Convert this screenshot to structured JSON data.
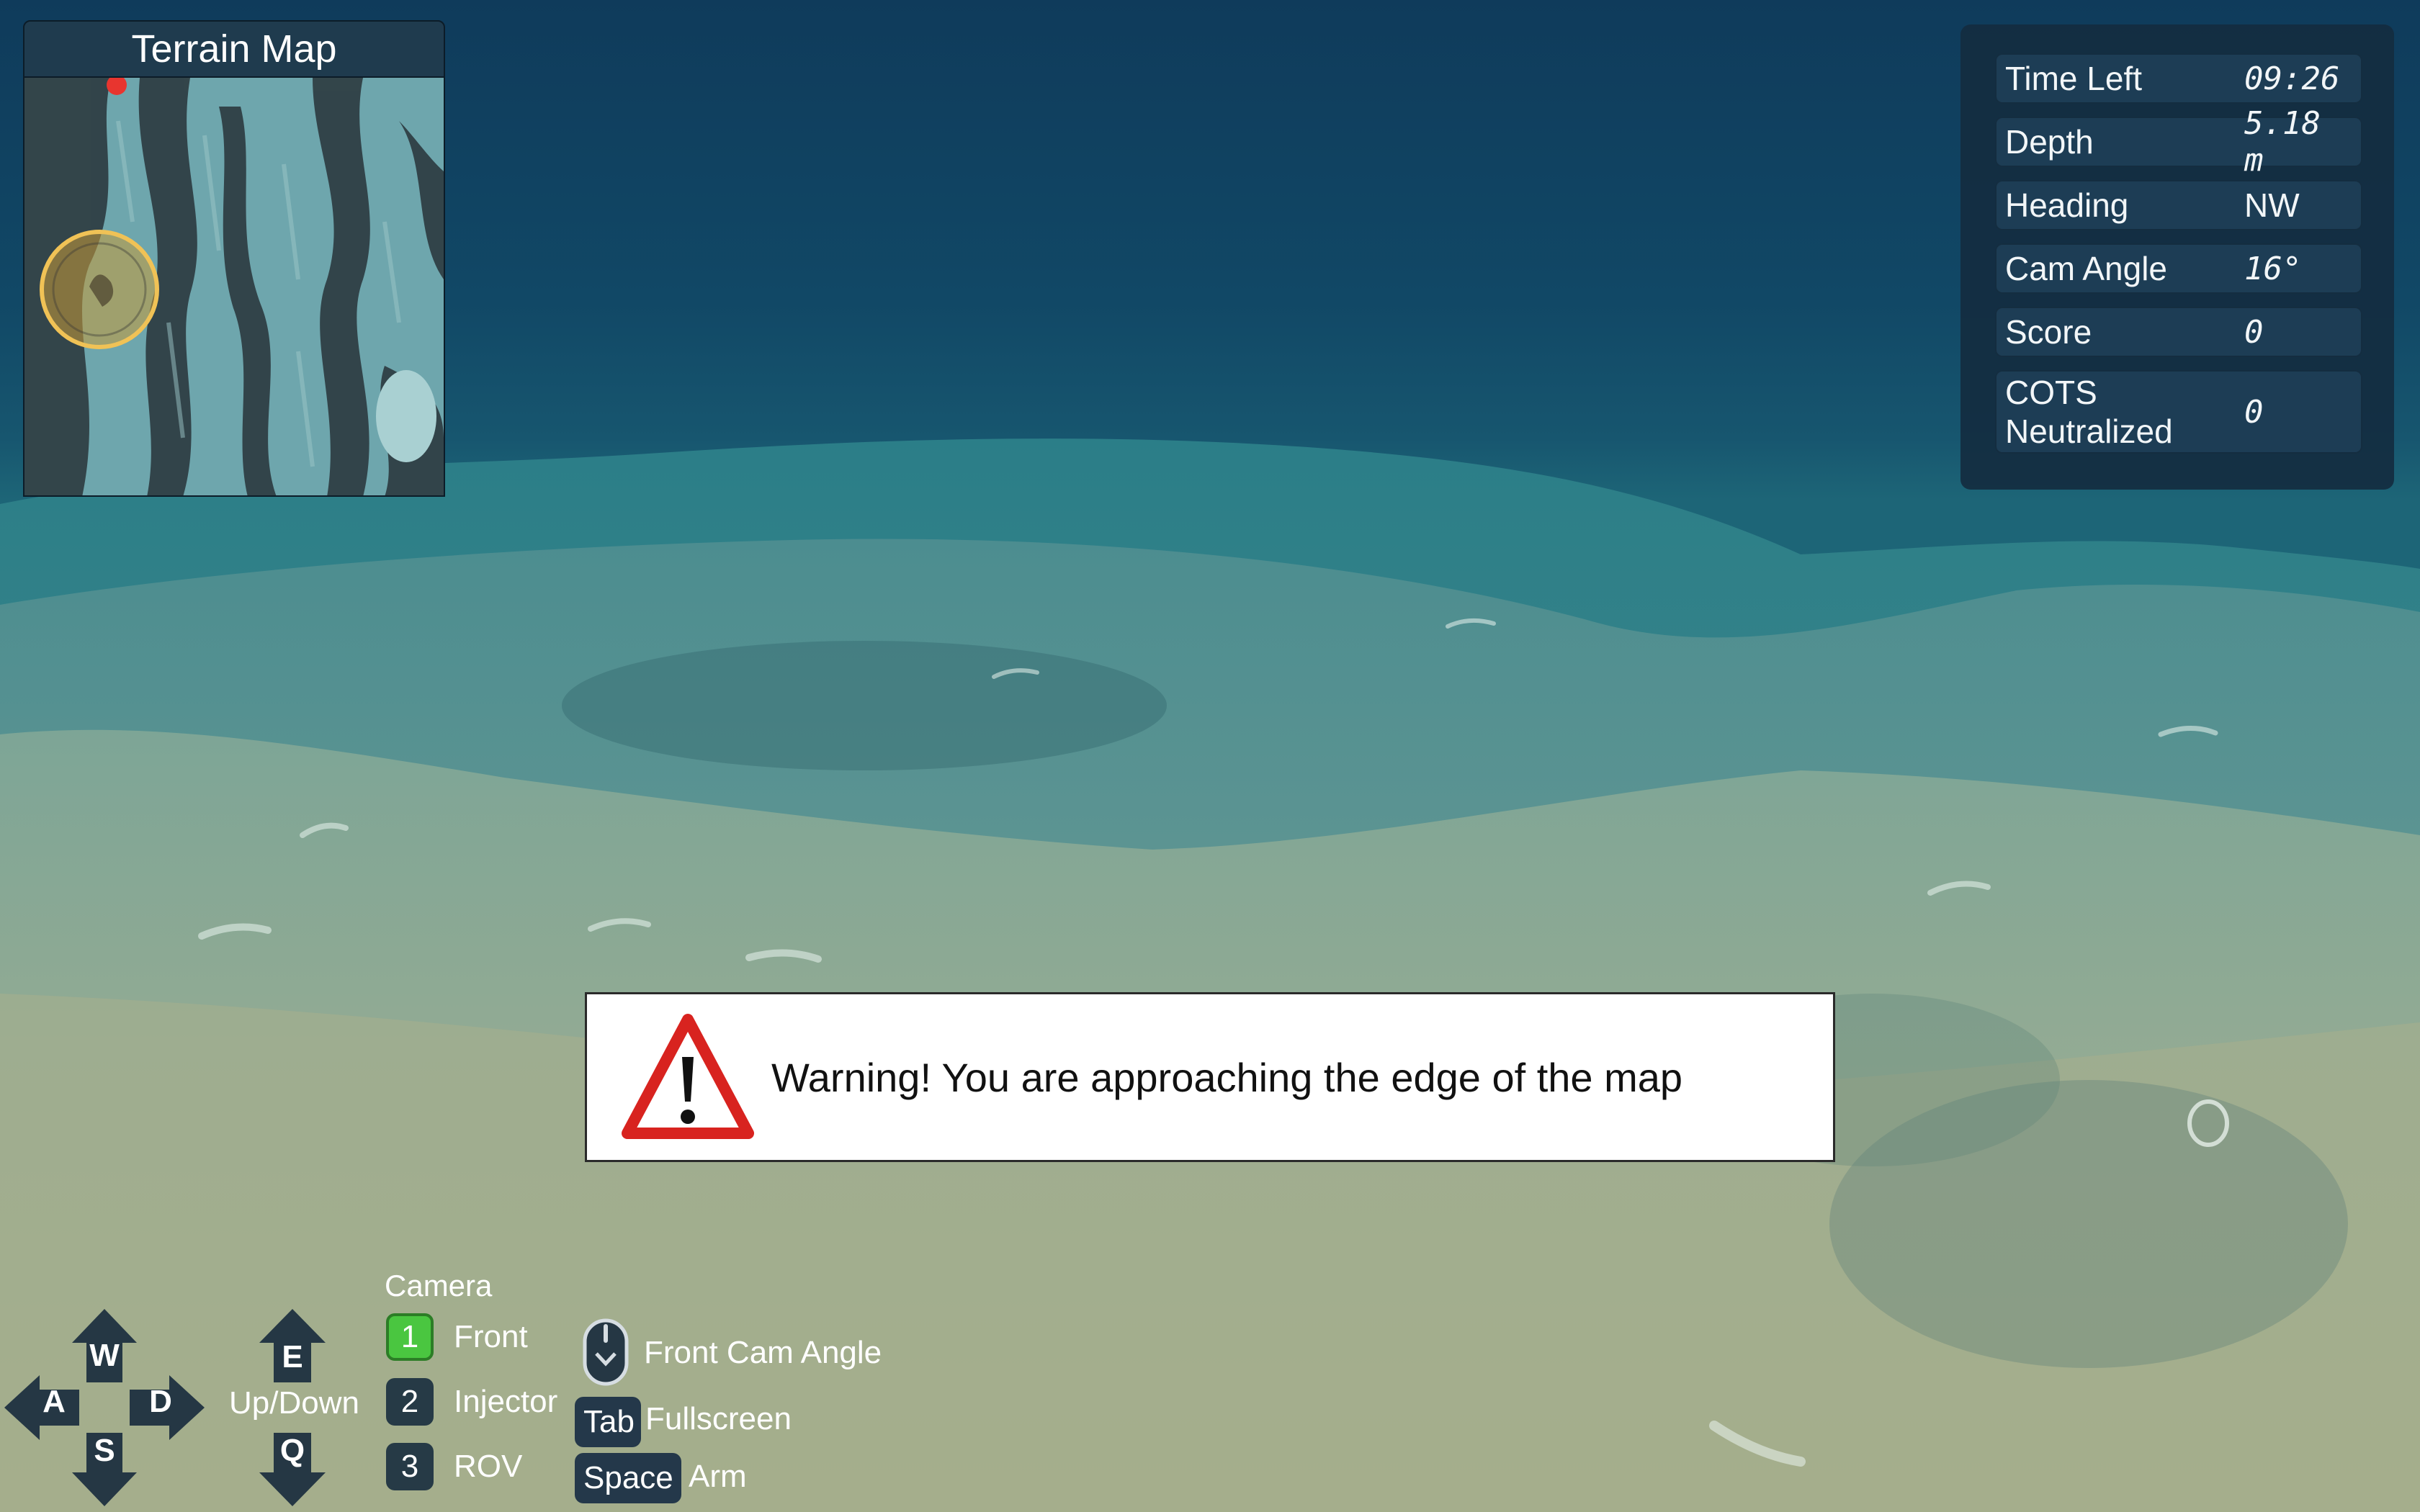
{
  "terrain_map": {
    "title": "Terrain Map"
  },
  "stats": {
    "time_left": {
      "label": "Time Left",
      "value": "09:26"
    },
    "depth": {
      "label": "Depth",
      "value": "5.18 m"
    },
    "heading": {
      "label": "Heading",
      "value": "NW"
    },
    "cam_angle": {
      "label": "Cam Angle",
      "value": "16°"
    },
    "score": {
      "label": "Score",
      "value": "0"
    },
    "cots": {
      "label": "COTS Neutralized",
      "value": "0"
    }
  },
  "warning": {
    "message": "Warning! You are approaching the edge of the map",
    "icon": "warning-triangle-icon",
    "color": "#d8231f"
  },
  "controls": {
    "move_keys": {
      "up": "W",
      "left": "A",
      "right": "D",
      "down": "S"
    },
    "vertical_keys": {
      "up": "E",
      "down": "Q",
      "label": "Up/Down"
    },
    "camera": {
      "heading": "Camera",
      "options": [
        {
          "key": "1",
          "label": "Front",
          "active": true
        },
        {
          "key": "2",
          "label": "Injector",
          "active": false
        },
        {
          "key": "3",
          "label": "ROV",
          "active": false
        }
      ]
    },
    "mouse": {
      "icon": "mouse-icon",
      "label": "Front Cam Angle"
    },
    "tab": {
      "key": "Tab",
      "label": "Fullscreen"
    },
    "space": {
      "key": "Space",
      "label": "Arm"
    }
  },
  "colors": {
    "active_camera": "#4ac640",
    "player_marker": "#e9b84a",
    "map_marker": "#e8352f"
  }
}
